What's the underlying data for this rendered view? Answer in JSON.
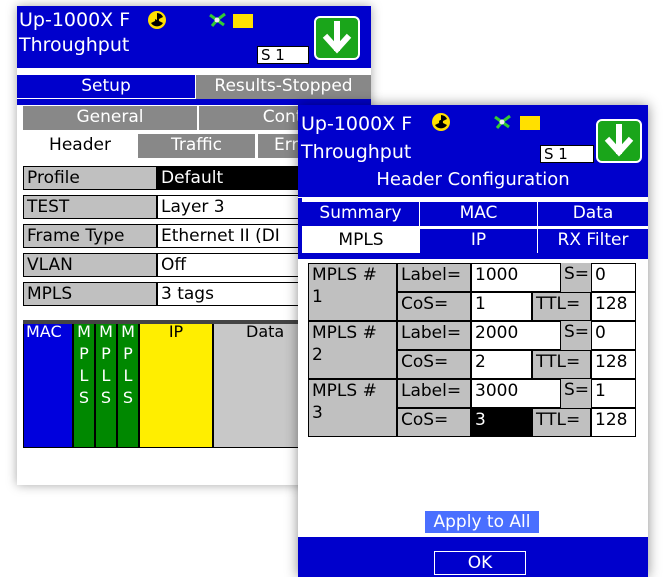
{
  "screen1": {
    "title_line1": "Up-1000X F",
    "title_line2": "Throughput",
    "session_box": "S 1",
    "tabs_row1": [
      "Setup",
      "Results-Stopped"
    ],
    "tabs_row2": [
      "General",
      "Conti"
    ],
    "tabs_row3": [
      "Header",
      "Traffic",
      "Err"
    ],
    "rows": [
      {
        "label": "Profile",
        "value": "Default"
      },
      {
        "label": "TEST",
        "value": "Layer 3"
      },
      {
        "label": "Frame Type",
        "value": "Ethernet II (DI"
      },
      {
        "label": "VLAN",
        "value": "Off"
      },
      {
        "label": "MPLS",
        "value": "3 tags"
      }
    ],
    "frame_diagram": {
      "mac": "MAC",
      "mpls_letters": [
        "M",
        "P",
        "L",
        "S"
      ],
      "ip": "IP",
      "data": "Data"
    }
  },
  "screen2": {
    "title_line1": "Up-1000X F",
    "title_line2": "Throughput",
    "session_box": "S 1",
    "header_title": "Header Configuration",
    "tabs_row1": [
      "Summary",
      "MAC",
      "Data"
    ],
    "tabs_row2": [
      "MPLS",
      "IP",
      "RX Filter"
    ],
    "mpls_rows": [
      {
        "name_line1": "MPLS #",
        "name_line2": "1",
        "label_lbl": "Label=",
        "label": "1000",
        "s_lbl": "S=",
        "s": "0",
        "cos_lbl": "CoS=",
        "cos": "1",
        "ttl_lbl": "TTL=",
        "ttl": "128"
      },
      {
        "name_line1": "MPLS #",
        "name_line2": "2",
        "label_lbl": "Label=",
        "label": "2000",
        "s_lbl": "S=",
        "s": "0",
        "cos_lbl": "CoS=",
        "cos": "2",
        "ttl_lbl": "TTL=",
        "ttl": "128"
      },
      {
        "name_line1": "MPLS #",
        "name_line2": "3",
        "label_lbl": "Label=",
        "label": "3000",
        "s_lbl": "S=",
        "s": "1",
        "cos_lbl": "CoS=",
        "cos": "3",
        "ttl_lbl": "TTL=",
        "ttl": "128"
      }
    ],
    "apply_all": "Apply to All",
    "ok": "OK"
  },
  "colors": {
    "title_blue": "#0000cc",
    "tab_gray": "#888888",
    "label_gray": "#c0c0c0",
    "mac_blue": "#0000dd",
    "mpls_green": "#008800",
    "ip_yellow": "#ffee00",
    "download_green": "#1aa51a",
    "radio_yellow": "#ffe000"
  },
  "icons": [
    "radiation-icon",
    "network-icon",
    "folder-icon",
    "download-arrow-icon"
  ]
}
